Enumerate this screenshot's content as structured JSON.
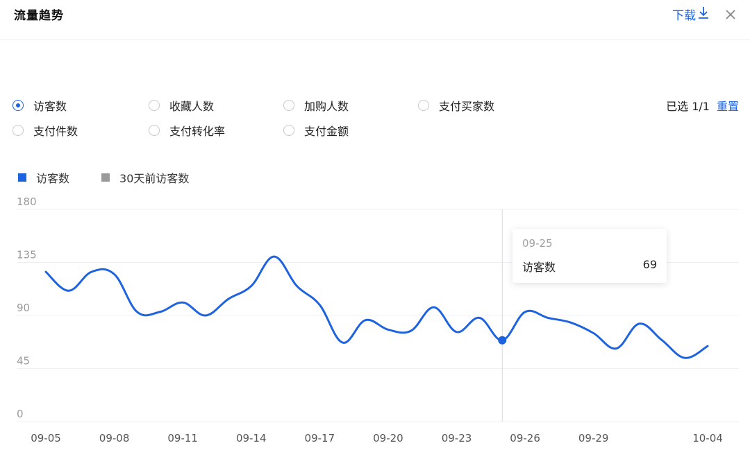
{
  "header": {
    "title": "流量趋势",
    "download_label": "下载",
    "download_icon": "download-arrow-icon",
    "close_icon": "close-icon"
  },
  "metrics": [
    {
      "label": "访客数",
      "checked": true
    },
    {
      "label": "收藏人数",
      "checked": false
    },
    {
      "label": "加购人数",
      "checked": false
    },
    {
      "label": "支付买家数",
      "checked": false
    },
    {
      "label": "支付件数",
      "checked": false
    },
    {
      "label": "支付转化率",
      "checked": false
    },
    {
      "label": "支付金额",
      "checked": false
    }
  ],
  "selection": {
    "text": "已选 1/1",
    "reset_label": "重置"
  },
  "legend": [
    {
      "label": "访客数",
      "color": "#1d63e0"
    },
    {
      "label": "30天前访客数",
      "color": "#9a9a9a"
    }
  ],
  "chart_data": {
    "type": "line",
    "x": [
      "09-05",
      "09-06",
      "09-07",
      "09-08",
      "09-09",
      "09-10",
      "09-11",
      "09-12",
      "09-13",
      "09-14",
      "09-15",
      "09-16",
      "09-17",
      "09-18",
      "09-19",
      "09-20",
      "09-21",
      "09-22",
      "09-23",
      "09-24",
      "09-25",
      "09-26",
      "09-27",
      "09-28",
      "09-29",
      "09-30",
      "10-01",
      "10-02",
      "10-03",
      "10-04"
    ],
    "series": [
      {
        "name": "访客数",
        "color": "#1d63e0",
        "values": [
          127,
          111,
          127,
          125,
          93,
          93,
          101,
          90,
          104,
          115,
          140,
          115,
          99,
          67,
          86,
          78,
          77,
          97,
          76,
          88,
          69,
          93,
          88,
          84,
          75,
          62,
          83,
          69,
          54,
          64
        ]
      }
    ],
    "xticks": [
      "09-05",
      "09-08",
      "09-11",
      "09-14",
      "09-17",
      "09-20",
      "09-23",
      "09-26",
      "09-29",
      "10-04"
    ],
    "yticks": [
      0,
      45,
      90,
      135,
      180
    ],
    "ylim": [
      0,
      180
    ],
    "title": "",
    "xlabel": "",
    "ylabel": "",
    "tooltip": {
      "date": "09-25",
      "label": "访客数",
      "value": "69"
    }
  }
}
